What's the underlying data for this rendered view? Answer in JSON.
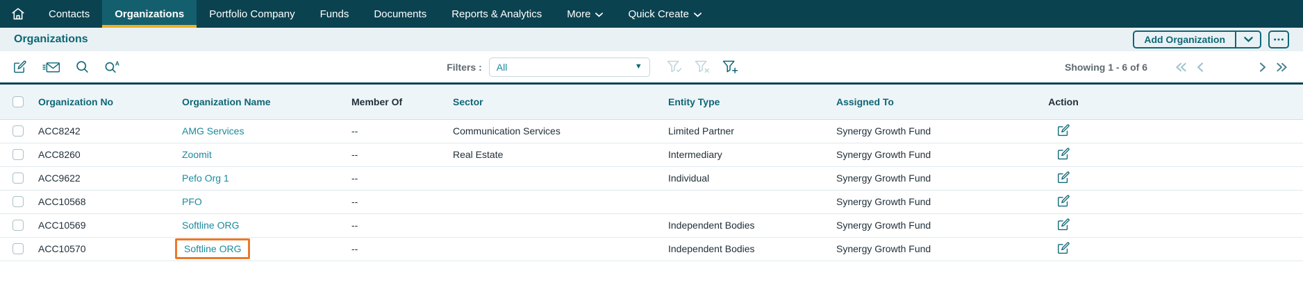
{
  "navbar": {
    "items": [
      {
        "label": "Contacts",
        "active": false,
        "chevron": false
      },
      {
        "label": "Organizations",
        "active": true,
        "chevron": false
      },
      {
        "label": "Portfolio Company",
        "active": false,
        "chevron": false
      },
      {
        "label": "Funds",
        "active": false,
        "chevron": false
      },
      {
        "label": "Documents",
        "active": false,
        "chevron": false
      },
      {
        "label": "Reports & Analytics",
        "active": false,
        "chevron": false
      },
      {
        "label": "More",
        "active": false,
        "chevron": true
      },
      {
        "label": "Quick Create",
        "active": false,
        "chevron": true
      }
    ]
  },
  "header": {
    "title": "Organizations",
    "add_button_label": "Add Organization"
  },
  "toolbar": {
    "filters_label": "Filters :",
    "filter_value": "All",
    "showing": "Showing 1 - 6 of 6",
    "icons": [
      "compose-icon",
      "email-icon",
      "search-icon",
      "advanced-search-icon"
    ],
    "filter_icons": [
      {
        "name": "filter-applied-icon",
        "enabled": false
      },
      {
        "name": "filter-clear-icon",
        "enabled": false
      },
      {
        "name": "filter-add-icon",
        "enabled": true
      }
    ]
  },
  "colors": {
    "navbar": "#0b4250",
    "active_tab": "#145f6e",
    "tab_underline": "#eeb021",
    "accent_teal": "#0d6775",
    "link_teal": "#1a8a9e",
    "highlight_orange": "#e8792a"
  },
  "table": {
    "columns": [
      {
        "key": "org_no",
        "label": "Organization No",
        "style": "teal"
      },
      {
        "key": "org_name",
        "label": "Organization Name",
        "style": "teal"
      },
      {
        "key": "member_of",
        "label": "Member Of",
        "style": "dark"
      },
      {
        "key": "sector",
        "label": "Sector",
        "style": "teal"
      },
      {
        "key": "entity_type",
        "label": "Entity Type",
        "style": "teal"
      },
      {
        "key": "assigned_to",
        "label": "Assigned To",
        "style": "teal"
      },
      {
        "key": "action",
        "label": "Action",
        "style": "dark"
      }
    ],
    "rows": [
      {
        "org_no": "ACC8242",
        "org_name": "AMG Services",
        "member_of": "--",
        "sector": "Communication Services",
        "entity_type": "Limited Partner",
        "assigned_to": "Synergy Growth Fund",
        "highlight": false
      },
      {
        "org_no": "ACC8260",
        "org_name": "Zoomit",
        "member_of": "--",
        "sector": "Real Estate",
        "entity_type": "Intermediary",
        "assigned_to": "Synergy Growth Fund",
        "highlight": false
      },
      {
        "org_no": "ACC9622",
        "org_name": "Pefo Org 1",
        "member_of": "--",
        "sector": "",
        "entity_type": "Individual",
        "assigned_to": "Synergy Growth Fund",
        "highlight": false
      },
      {
        "org_no": "ACC10568",
        "org_name": "PFO",
        "member_of": "--",
        "sector": "",
        "entity_type": "",
        "assigned_to": "Synergy Growth Fund",
        "highlight": false
      },
      {
        "org_no": "ACC10569",
        "org_name": "Softline ORG",
        "member_of": "--",
        "sector": "",
        "entity_type": "Independent Bodies",
        "assigned_to": "Synergy Growth Fund",
        "highlight": false
      },
      {
        "org_no": "ACC10570",
        "org_name": "Softline ORG",
        "member_of": "--",
        "sector": "",
        "entity_type": "Independent Bodies",
        "assigned_to": "Synergy Growth Fund",
        "highlight": true
      }
    ]
  }
}
